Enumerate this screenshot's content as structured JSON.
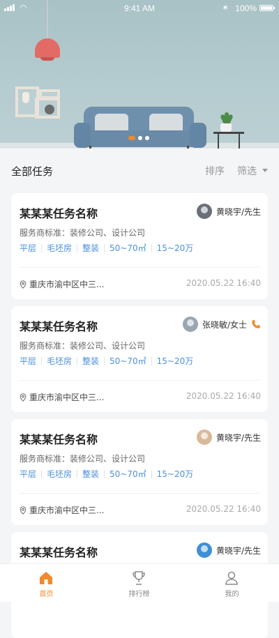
{
  "status_bar": {
    "time": "9:41 AM",
    "battery": "100%"
  },
  "banner": {
    "pages": 3,
    "active_page": 1
  },
  "section": {
    "title": "全部任务",
    "sort_label": "排序",
    "filter_label": "筛选"
  },
  "tasks": [
    {
      "title": "某某某任务名称",
      "contact_name": "黄晓宇/先生",
      "avatar_color": "#6b6f78",
      "has_phone": false,
      "provider": "服务商标准：装修公司、设计公司",
      "tags": [
        "平层",
        "毛坯房",
        "整装",
        "50~70㎡",
        "15~20万"
      ],
      "location": "重庆市渝中区中三...",
      "datetime": "2020.05.22 16:40"
    },
    {
      "title": "某某某任务名称",
      "contact_name": "张晓敏/女士",
      "avatar_color": "#9aa6b2",
      "has_phone": true,
      "provider": "服务商标准：装修公司、设计公司",
      "tags": [
        "平层",
        "毛坯房",
        "整装",
        "50~70㎡",
        "15~20万"
      ],
      "location": "重庆市渝中区中三...",
      "datetime": "2020.05.22 16:40"
    },
    {
      "title": "某某某任务名称",
      "contact_name": "黄晓宇/先生",
      "avatar_color": "#d9b99b",
      "has_phone": false,
      "provider": "服务商标准：装修公司、设计公司",
      "tags": [
        "平层",
        "毛坯房",
        "整装",
        "50~70㎡",
        "15~20万"
      ],
      "location": "重庆市渝中区中三...",
      "datetime": "2020.05.22 16:40"
    },
    {
      "title": "某某某任务名称",
      "contact_name": "黄晓宇/先生",
      "avatar_color": "#3f8fd6",
      "has_phone": false,
      "provider": "",
      "tags": [],
      "location": "",
      "datetime": ""
    }
  ],
  "tabbar": {
    "items": [
      {
        "label": "首页",
        "icon": "home-icon",
        "active": true
      },
      {
        "label": "排行榜",
        "icon": "trophy-icon",
        "active": false
      },
      {
        "label": "我的",
        "icon": "user-icon",
        "active": false
      }
    ]
  },
  "colors": {
    "accent": "#f08a2c",
    "tag_blue": "#4a90e2",
    "background": "#f4f5f7"
  }
}
